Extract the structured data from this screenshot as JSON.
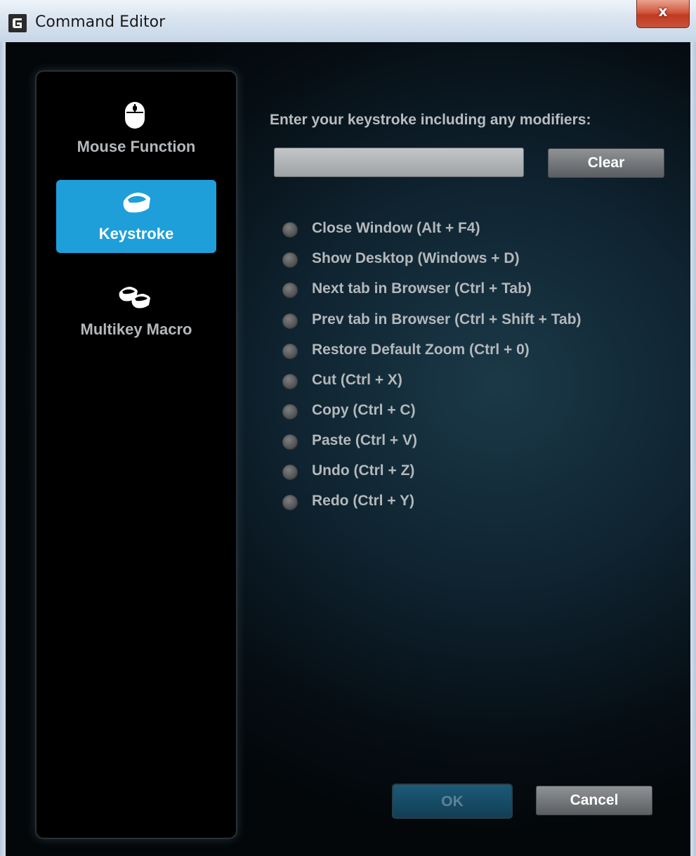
{
  "window": {
    "title": "Command Editor",
    "close_glyph": "x",
    "logo_icon": "logitech-g-icon"
  },
  "sidebar": {
    "items": [
      {
        "label": "Mouse Function",
        "icon": "mouse-icon",
        "active": false
      },
      {
        "label": "Keystroke",
        "icon": "keycap-icon",
        "active": true
      },
      {
        "label": "Multikey Macro",
        "icon": "multikey-icon",
        "active": false
      }
    ]
  },
  "keystroke": {
    "prompt": "Enter your keystroke including any modifiers:",
    "input_value": "",
    "clear_label": "Clear"
  },
  "presets": [
    "Close Window (Alt + F4)",
    "Show Desktop (Windows + D)",
    "Next tab in Browser (Ctrl + Tab)",
    "Prev tab in Browser (Ctrl + Shift + Tab)",
    "Restore Default Zoom (Ctrl + 0)",
    "Cut (Ctrl + X)",
    "Copy (Ctrl + C)",
    "Paste (Ctrl + V)",
    "Undo (Ctrl + Z)",
    "Redo (Ctrl + Y)"
  ],
  "footer": {
    "ok_label": "OK",
    "cancel_label": "Cancel"
  },
  "colors": {
    "accent": "#1f9fd9",
    "ok_button": "#164a64",
    "text_gray": "#b4b8bb"
  }
}
